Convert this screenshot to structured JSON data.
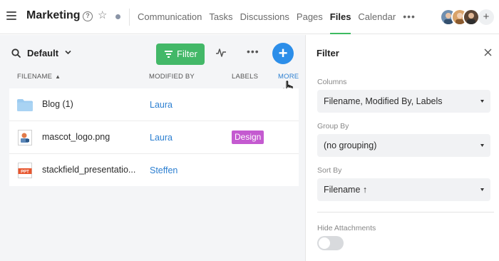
{
  "header": {
    "workspace_title": "Marketing",
    "nav": [
      "Communication",
      "Tasks",
      "Discussions",
      "Pages",
      "Files",
      "Calendar"
    ],
    "active_nav": "Files",
    "more_label": "•••",
    "add_member_label": "+"
  },
  "toolbar": {
    "view_name": "Default",
    "filter_label": "Filter",
    "more_label": "•••",
    "add_label": "+"
  },
  "table": {
    "columns": {
      "filename": "FILENAME",
      "modified_by": "MODIFIED BY",
      "labels": "LABELS",
      "more": "MORE"
    },
    "sort_indicator": "▲",
    "rows": [
      {
        "name": "Blog (1)",
        "modified_by": "Laura",
        "label": "",
        "icon": "folder-icon"
      },
      {
        "name": "mascot_logo.png",
        "modified_by": "Laura",
        "label": "Design",
        "icon": "image-file-icon"
      },
      {
        "name": "stackfield_presentatio...",
        "modified_by": "Steffen",
        "label": "",
        "icon": "ppt-file-icon",
        "icon_text": "PPT"
      }
    ]
  },
  "panel": {
    "title": "Filter",
    "columns_label": "Columns",
    "columns_value": "Filename, Modified By, Labels",
    "group_label": "Group By",
    "group_value": "(no grouping)",
    "sort_label": "Sort By",
    "sort_value": "Filename ↑",
    "hide_attachments_label": "Hide Attachments",
    "hide_attachments_on": false
  },
  "colors": {
    "accent_green": "#43b868",
    "accent_blue": "#2c8ee9",
    "label_design": "#c45ad0",
    "link_blue": "#2c7fd1"
  }
}
